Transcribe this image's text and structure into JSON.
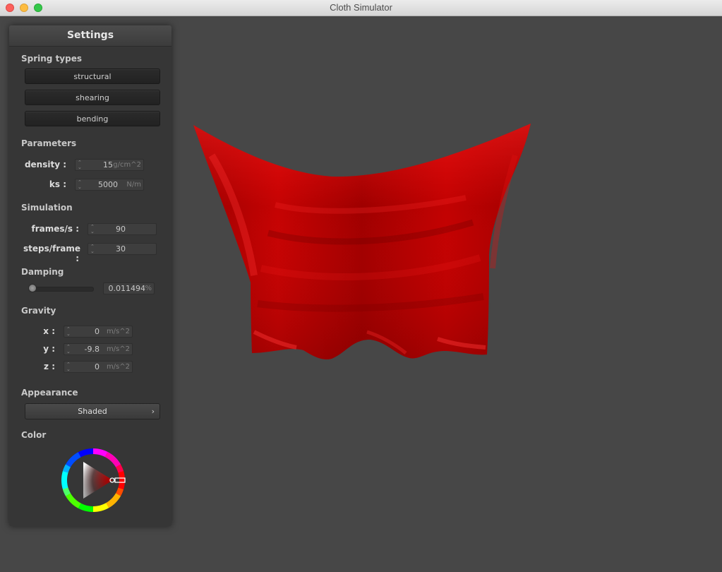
{
  "window": {
    "title": "Cloth Simulator"
  },
  "panel": {
    "title": "Settings"
  },
  "spring_types": {
    "label": "Spring types",
    "buttons": [
      "structural",
      "shearing",
      "bending"
    ]
  },
  "parameters": {
    "label": "Parameters",
    "density": {
      "label": "density :",
      "value": "15",
      "unit": "g/cm^2"
    },
    "ks": {
      "label": "ks :",
      "value": "5000",
      "unit": "N/m"
    }
  },
  "simulation": {
    "label": "Simulation",
    "frames": {
      "label": "frames/s :",
      "value": "90"
    },
    "steps": {
      "label": "steps/frame :",
      "value": "30"
    }
  },
  "damping": {
    "label": "Damping",
    "value": "0.011494",
    "unit": "%",
    "slider_fraction": 0.0
  },
  "gravity": {
    "label": "Gravity",
    "x": {
      "label": "x :",
      "value": "0",
      "unit": "m/s^2"
    },
    "y": {
      "label": "y :",
      "value": "-9.8",
      "unit": "m/s^2"
    },
    "z": {
      "label": "z :",
      "value": "0",
      "unit": "m/s^2"
    }
  },
  "appearance": {
    "label": "Appearance",
    "selected": "Shaded"
  },
  "color": {
    "label": "Color",
    "selected_hex": "#d40000"
  }
}
